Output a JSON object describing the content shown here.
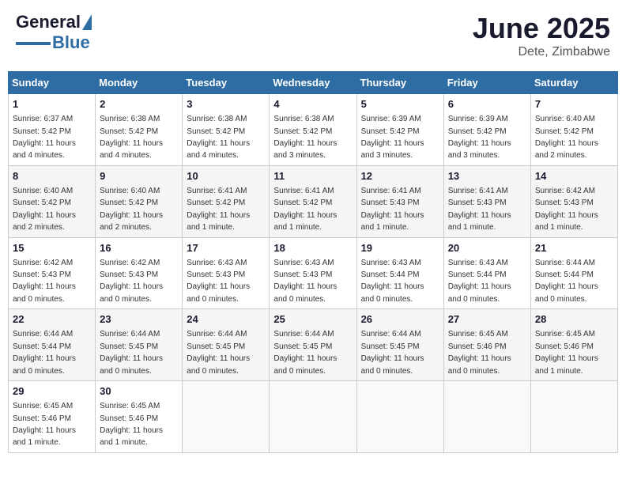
{
  "header": {
    "logo_general": "General",
    "logo_blue": "Blue",
    "month": "June 2025",
    "location": "Dete, Zimbabwe"
  },
  "days_of_week": [
    "Sunday",
    "Monday",
    "Tuesday",
    "Wednesday",
    "Thursday",
    "Friday",
    "Saturday"
  ],
  "weeks": [
    [
      {
        "day": "1",
        "sunrise": "6:37 AM",
        "sunset": "5:42 PM",
        "daylight": "11 hours and 4 minutes."
      },
      {
        "day": "2",
        "sunrise": "6:38 AM",
        "sunset": "5:42 PM",
        "daylight": "11 hours and 4 minutes."
      },
      {
        "day": "3",
        "sunrise": "6:38 AM",
        "sunset": "5:42 PM",
        "daylight": "11 hours and 4 minutes."
      },
      {
        "day": "4",
        "sunrise": "6:38 AM",
        "sunset": "5:42 PM",
        "daylight": "11 hours and 3 minutes."
      },
      {
        "day": "5",
        "sunrise": "6:39 AM",
        "sunset": "5:42 PM",
        "daylight": "11 hours and 3 minutes."
      },
      {
        "day": "6",
        "sunrise": "6:39 AM",
        "sunset": "5:42 PM",
        "daylight": "11 hours and 3 minutes."
      },
      {
        "day": "7",
        "sunrise": "6:40 AM",
        "sunset": "5:42 PM",
        "daylight": "11 hours and 2 minutes."
      }
    ],
    [
      {
        "day": "8",
        "sunrise": "6:40 AM",
        "sunset": "5:42 PM",
        "daylight": "11 hours and 2 minutes."
      },
      {
        "day": "9",
        "sunrise": "6:40 AM",
        "sunset": "5:42 PM",
        "daylight": "11 hours and 2 minutes."
      },
      {
        "day": "10",
        "sunrise": "6:41 AM",
        "sunset": "5:42 PM",
        "daylight": "11 hours and 1 minute."
      },
      {
        "day": "11",
        "sunrise": "6:41 AM",
        "sunset": "5:42 PM",
        "daylight": "11 hours and 1 minute."
      },
      {
        "day": "12",
        "sunrise": "6:41 AM",
        "sunset": "5:43 PM",
        "daylight": "11 hours and 1 minute."
      },
      {
        "day": "13",
        "sunrise": "6:41 AM",
        "sunset": "5:43 PM",
        "daylight": "11 hours and 1 minute."
      },
      {
        "day": "14",
        "sunrise": "6:42 AM",
        "sunset": "5:43 PM",
        "daylight": "11 hours and 1 minute."
      }
    ],
    [
      {
        "day": "15",
        "sunrise": "6:42 AM",
        "sunset": "5:43 PM",
        "daylight": "11 hours and 0 minutes."
      },
      {
        "day": "16",
        "sunrise": "6:42 AM",
        "sunset": "5:43 PM",
        "daylight": "11 hours and 0 minutes."
      },
      {
        "day": "17",
        "sunrise": "6:43 AM",
        "sunset": "5:43 PM",
        "daylight": "11 hours and 0 minutes."
      },
      {
        "day": "18",
        "sunrise": "6:43 AM",
        "sunset": "5:43 PM",
        "daylight": "11 hours and 0 minutes."
      },
      {
        "day": "19",
        "sunrise": "6:43 AM",
        "sunset": "5:44 PM",
        "daylight": "11 hours and 0 minutes."
      },
      {
        "day": "20",
        "sunrise": "6:43 AM",
        "sunset": "5:44 PM",
        "daylight": "11 hours and 0 minutes."
      },
      {
        "day": "21",
        "sunrise": "6:44 AM",
        "sunset": "5:44 PM",
        "daylight": "11 hours and 0 minutes."
      }
    ],
    [
      {
        "day": "22",
        "sunrise": "6:44 AM",
        "sunset": "5:44 PM",
        "daylight": "11 hours and 0 minutes."
      },
      {
        "day": "23",
        "sunrise": "6:44 AM",
        "sunset": "5:45 PM",
        "daylight": "11 hours and 0 minutes."
      },
      {
        "day": "24",
        "sunrise": "6:44 AM",
        "sunset": "5:45 PM",
        "daylight": "11 hours and 0 minutes."
      },
      {
        "day": "25",
        "sunrise": "6:44 AM",
        "sunset": "5:45 PM",
        "daylight": "11 hours and 0 minutes."
      },
      {
        "day": "26",
        "sunrise": "6:44 AM",
        "sunset": "5:45 PM",
        "daylight": "11 hours and 0 minutes."
      },
      {
        "day": "27",
        "sunrise": "6:45 AM",
        "sunset": "5:46 PM",
        "daylight": "11 hours and 0 minutes."
      },
      {
        "day": "28",
        "sunrise": "6:45 AM",
        "sunset": "5:46 PM",
        "daylight": "11 hours and 1 minute."
      }
    ],
    [
      {
        "day": "29",
        "sunrise": "6:45 AM",
        "sunset": "5:46 PM",
        "daylight": "11 hours and 1 minute."
      },
      {
        "day": "30",
        "sunrise": "6:45 AM",
        "sunset": "5:46 PM",
        "daylight": "11 hours and 1 minute."
      },
      null,
      null,
      null,
      null,
      null
    ]
  ]
}
